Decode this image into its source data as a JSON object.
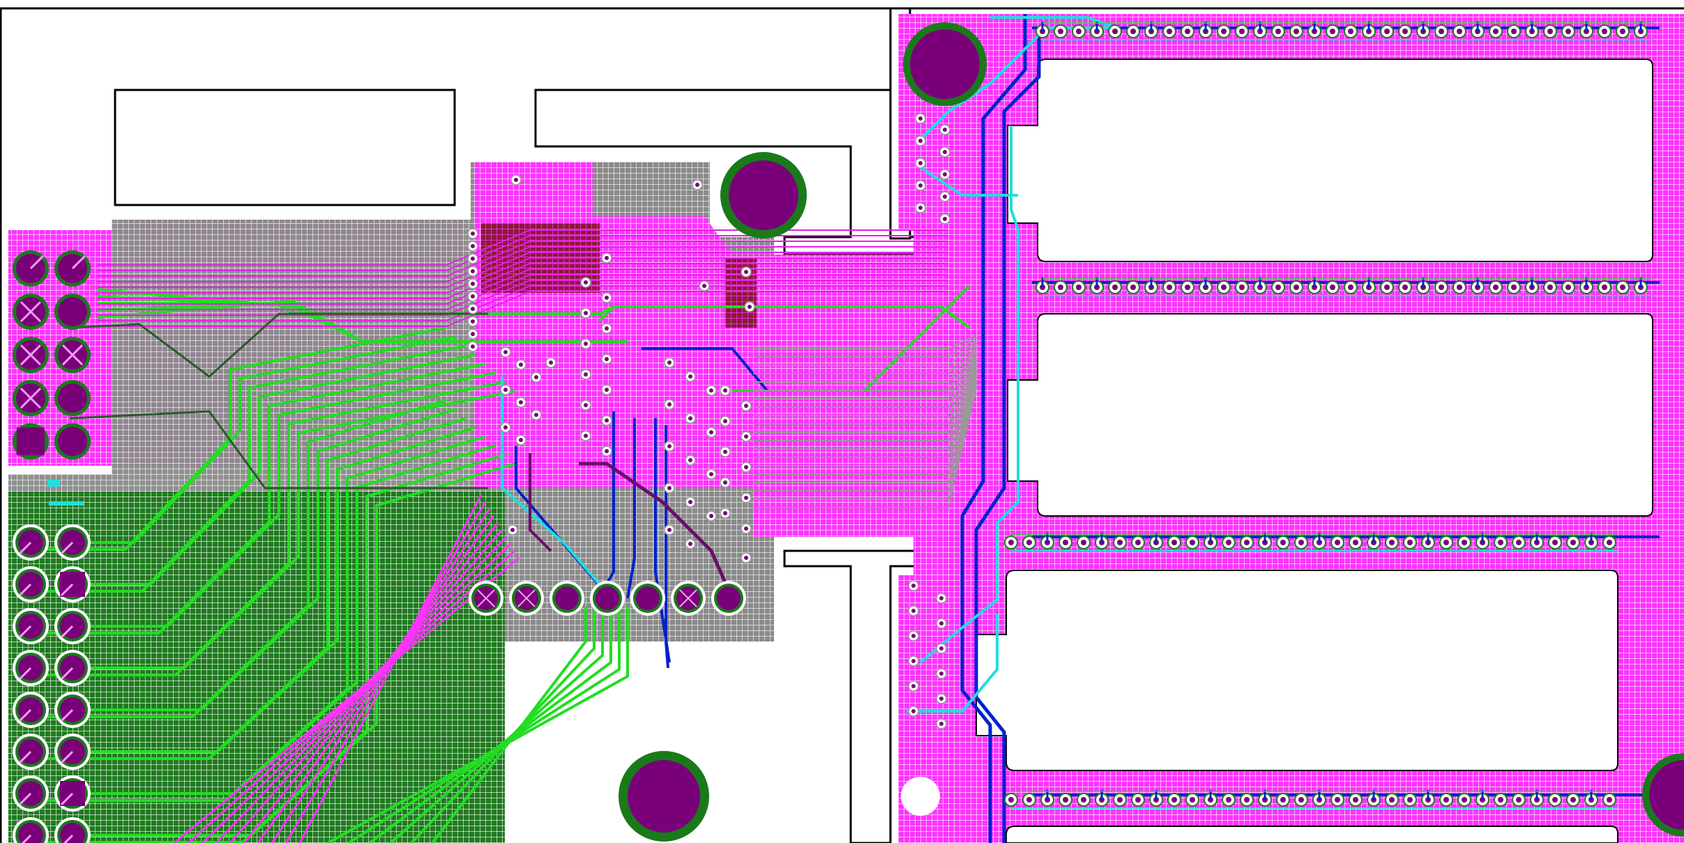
{
  "view": {
    "kind": "pcb-layout",
    "background": "#ffffff",
    "outline_color": "#000000"
  },
  "layer_colors": {
    "top_copper_pour": "#ff33ff",
    "bottom_copper_pour": "#228b22",
    "ground_pour": "#8c8c8c",
    "top_trace": "#22dd22",
    "bottom_trace": "#0022cc",
    "inner_trace": "#22dddd",
    "dark_trace": "#6b0d6b",
    "pad_fill": "#7a007a",
    "pad_ring": "#1a7a1a",
    "silk_outline": "#111111"
  },
  "components": {
    "left_header": {
      "rows": 5,
      "cols": 2,
      "marked_pins": [
        2,
        3,
        5,
        6,
        7
      ]
    },
    "left_lower_header": {
      "rows": 8,
      "cols": 2,
      "square_pins": [
        3,
        15
      ]
    },
    "bottom_pin_row": {
      "count": 7
    },
    "mounting_holes": 4,
    "dip_modules": 4
  }
}
